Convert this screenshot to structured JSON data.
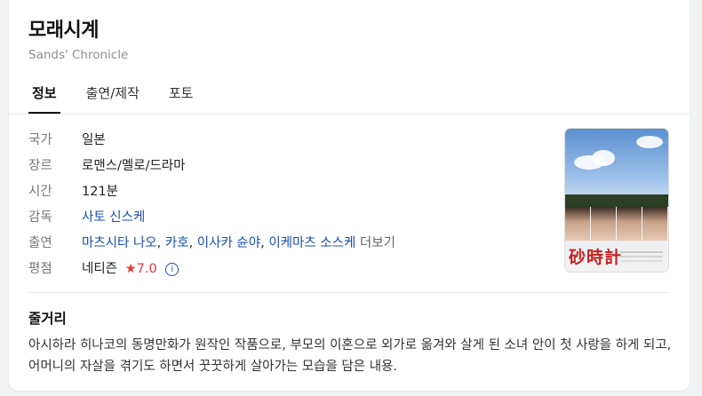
{
  "movie": {
    "title": "모래시계",
    "original_title": "Sands' Chronicle"
  },
  "tabs": [
    {
      "label": "정보",
      "active": true
    },
    {
      "label": "출연/제작",
      "active": false
    },
    {
      "label": "포토",
      "active": false
    }
  ],
  "info": {
    "country": {
      "label": "국가",
      "value": "일본"
    },
    "genre": {
      "label": "장르",
      "value": "로맨스/멜로/드라마"
    },
    "runtime": {
      "label": "시간",
      "value": "121분"
    },
    "director": {
      "label": "감독",
      "value": "사토 신스케"
    },
    "cast": {
      "label": "출연",
      "names": [
        "마츠시타 나오",
        "카호",
        "이사카 슌야",
        "이케마츠 소스케"
      ],
      "more": "더보기"
    },
    "rating": {
      "label": "평점",
      "source": "네티즌",
      "star": "★",
      "score": "7.0",
      "info_icon": "i"
    }
  },
  "poster": {
    "title": "砂時計"
  },
  "synopsis": {
    "heading": "줄거리",
    "text": "아시하라 히나코의 동명만화가 원작인 작품으로, 부모의 이혼으로 외가로 옮겨와 살게 된 소녀 안이 첫 사랑을 하게 되고, 어머니의 자살을 겪기도 하면서 꿋꿋하게 살아가는 모습을 담은 내용."
  },
  "colors": {
    "link": "#1a4fb5",
    "rating_star": "#e53a3a",
    "poster_title": "#c42020"
  }
}
